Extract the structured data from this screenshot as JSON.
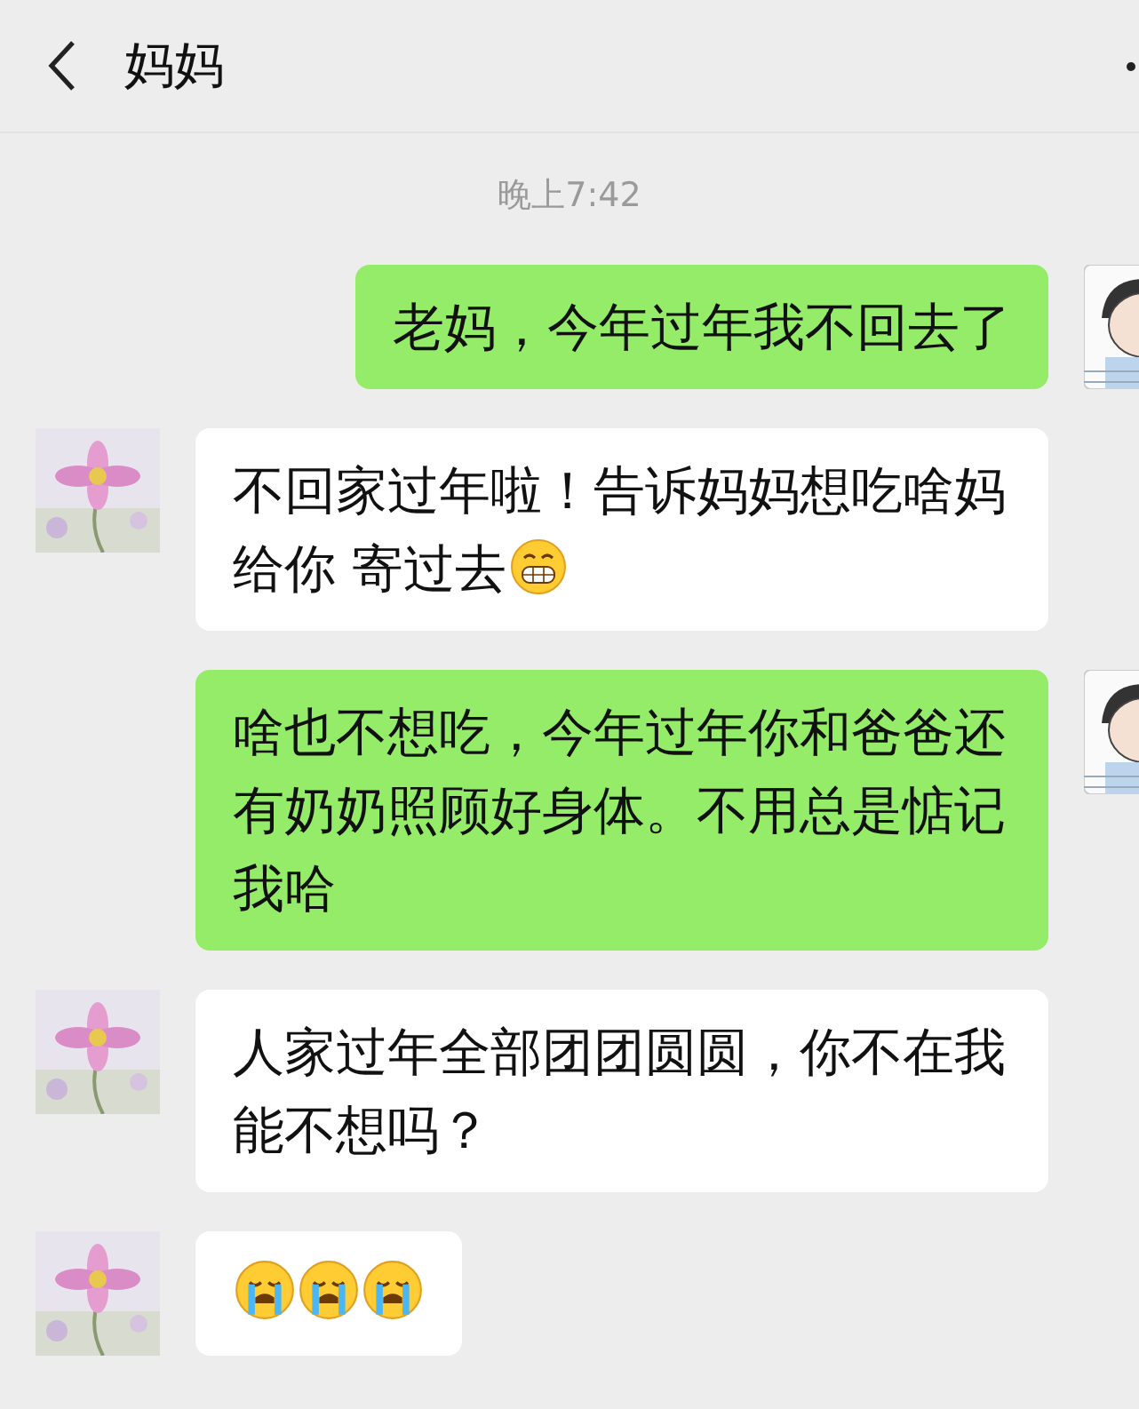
{
  "header": {
    "title": "妈妈"
  },
  "timestamp": "晚上7:42",
  "messages": [
    {
      "outgoing": true,
      "parts": [
        {
          "kind": "text",
          "text": "老妈，今年过年我不回去了"
        }
      ]
    },
    {
      "outgoing": false,
      "parts": [
        {
          "kind": "text",
          "text": "不回家过年啦！告诉妈妈想吃啥妈"
        },
        {
          "kind": "text",
          "text": "给你 寄过去"
        },
        {
          "kind": "grin"
        }
      ]
    },
    {
      "outgoing": true,
      "parts": [
        {
          "kind": "text",
          "text": "啥也不想吃，今年过年你和爸爸还有奶奶照顾好身体。不用总是惦记我哈"
        }
      ]
    },
    {
      "outgoing": false,
      "parts": [
        {
          "kind": "text",
          "text": "人家过年全部团团圆圆，你不在我能不想吗？"
        }
      ]
    },
    {
      "outgoing": false,
      "parts": [
        {
          "kind": "cry"
        },
        {
          "kind": "cry"
        },
        {
          "kind": "cry"
        }
      ]
    }
  ]
}
